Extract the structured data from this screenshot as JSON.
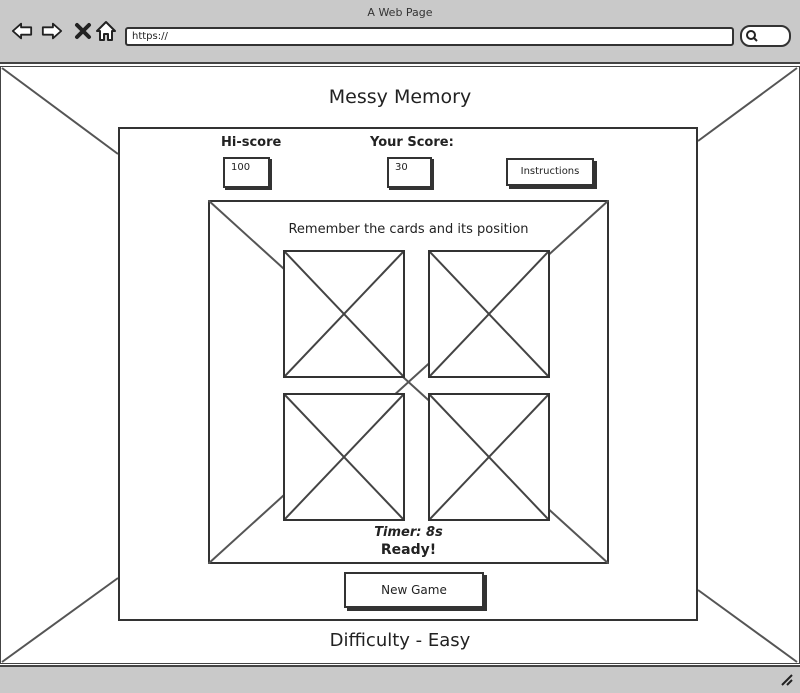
{
  "browser": {
    "window_title": "A Web Page",
    "url": "https://",
    "icons": [
      "back-arrow-icon",
      "forward-arrow-icon",
      "close-icon",
      "home-icon",
      "search-icon"
    ]
  },
  "page": {
    "title": "Messy Memory",
    "hiscore_label": "Hi-score",
    "hiscore_value": "100",
    "score_label": "Your Score:",
    "score_value": "30",
    "instructions_button": "Instructions",
    "board_instruction": "Remember the cards and its position",
    "timer": "Timer: 8s",
    "status": "Ready!",
    "new_game_button": "New Game",
    "difficulty": "Difficulty - Easy"
  }
}
